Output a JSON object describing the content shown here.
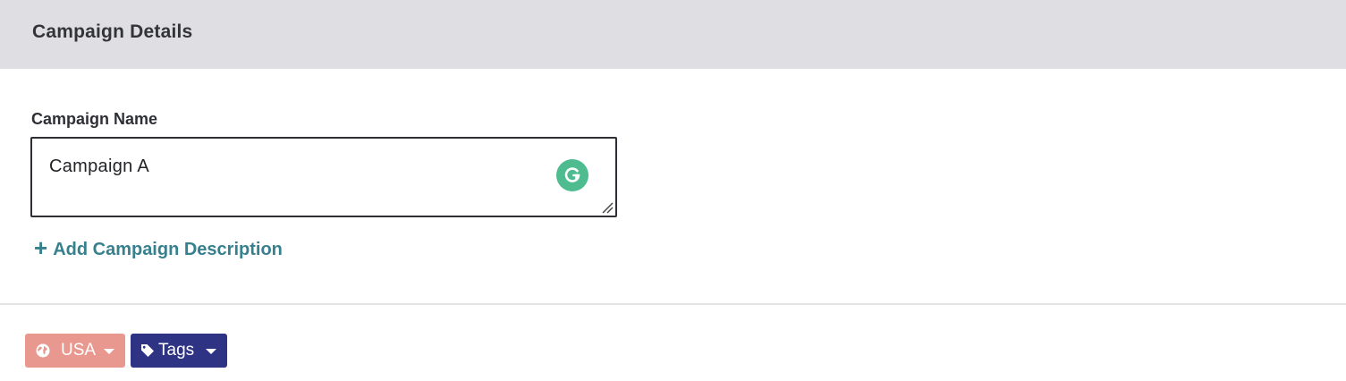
{
  "header": {
    "title": "Campaign Details"
  },
  "campaign_name": {
    "label": "Campaign Name",
    "value": "Campaign A",
    "grammarly_icon": "grammarly-icon"
  },
  "add_description": {
    "label": "Add Campaign Description",
    "icon": "plus-icon"
  },
  "filters": {
    "region": {
      "label": "USA",
      "icon": "globe-icon",
      "color": "#e99890"
    },
    "tags": {
      "label": "Tags",
      "icon": "tag-icon",
      "color": "#2e3384"
    }
  },
  "colors": {
    "accent": "#37808e",
    "header_bg": "#dfdfe3",
    "grammarly": "#4ebc8f"
  }
}
